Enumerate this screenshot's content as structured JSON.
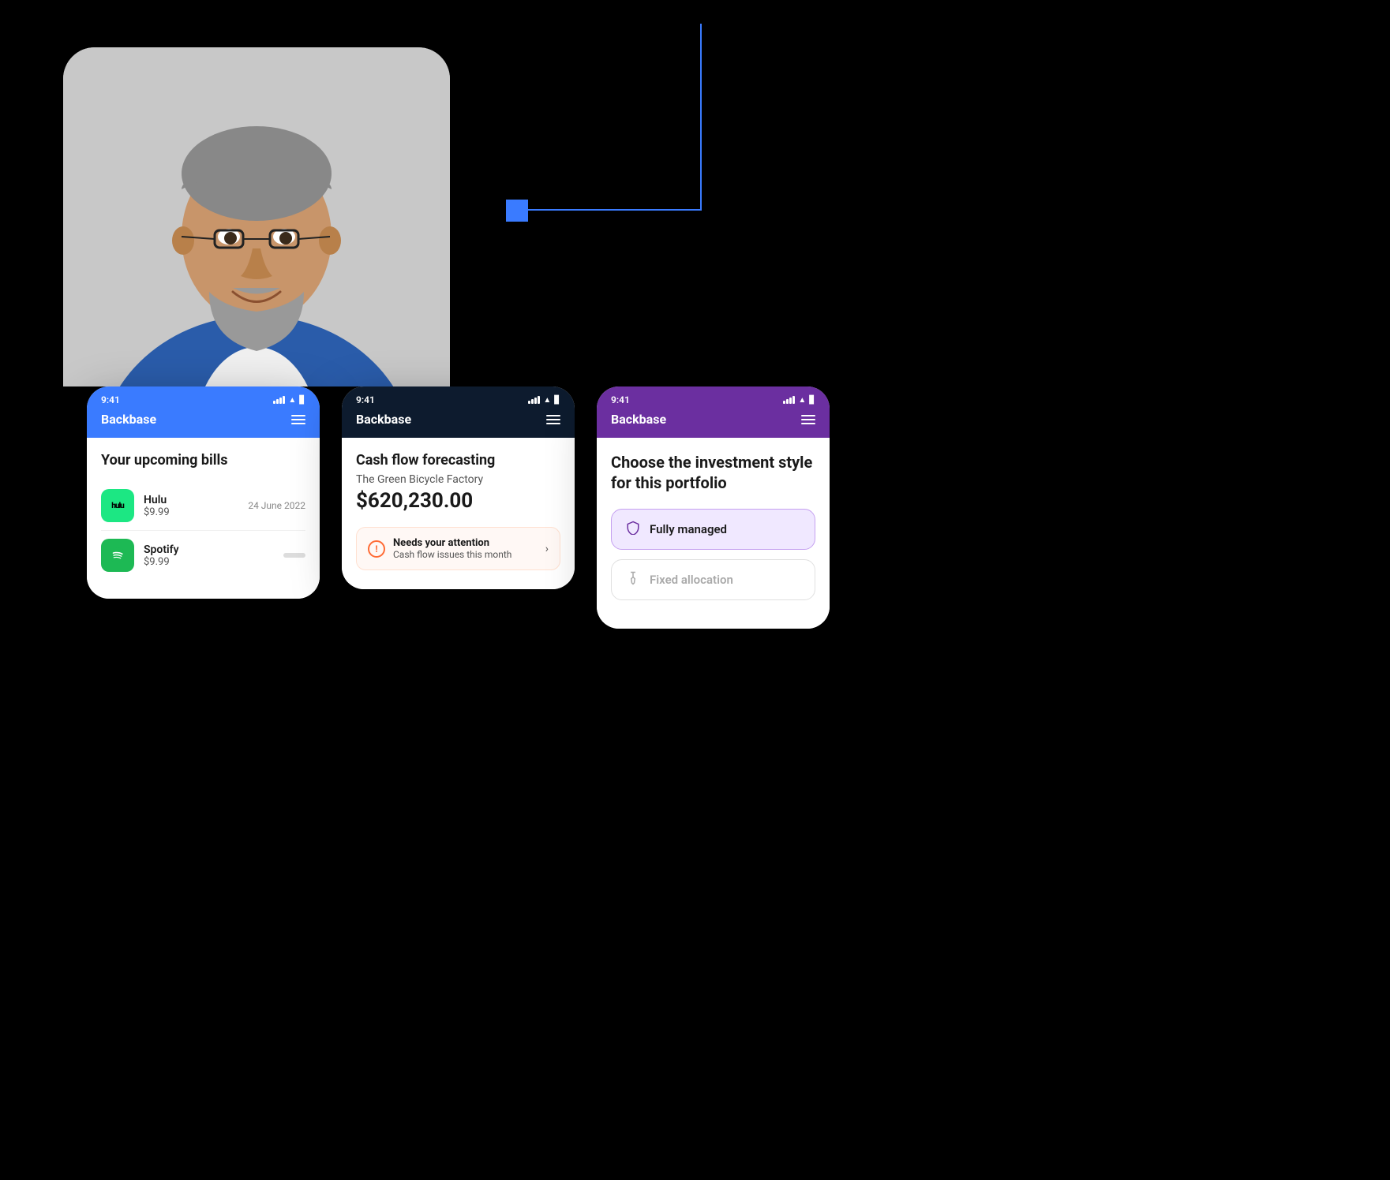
{
  "background": "#000000",
  "connector": {
    "color": "#3A7BFF"
  },
  "phone1": {
    "header": {
      "background": "#3A7BFF",
      "time": "9:41",
      "logo": "Backbase"
    },
    "body": {
      "title": "Your upcoming bills",
      "bills": [
        {
          "name": "Hulu",
          "price": "$9.99",
          "date": "24 June 2022",
          "logo_text": "hulu",
          "logo_bg": "#1CE783",
          "logo_color": "#000"
        },
        {
          "name": "Spotify",
          "price": "$9.99",
          "date": "",
          "logo_text": "♪",
          "logo_bg": "#1DB954",
          "logo_color": "#fff"
        }
      ]
    }
  },
  "phone2": {
    "header": {
      "background": "#0d1b2e",
      "time": "9:41",
      "logo": "Backbase"
    },
    "body": {
      "section_title": "Cash flow forecasting",
      "company": "The Green Bicycle Factory",
      "amount": "$620,230.00",
      "attention": {
        "title": "Needs your attention",
        "subtitle": "Cash flow issues this month"
      }
    }
  },
  "phone3": {
    "header": {
      "background": "#6B2FA0",
      "time": "9:41",
      "logo": "Backbase"
    },
    "body": {
      "title": "Choose the investment style for this portfolio",
      "options": [
        {
          "label": "Fully managed",
          "active": true,
          "icon": "🛡"
        },
        {
          "label": "Fixed allocation",
          "active": false,
          "icon": "📌"
        }
      ]
    }
  }
}
